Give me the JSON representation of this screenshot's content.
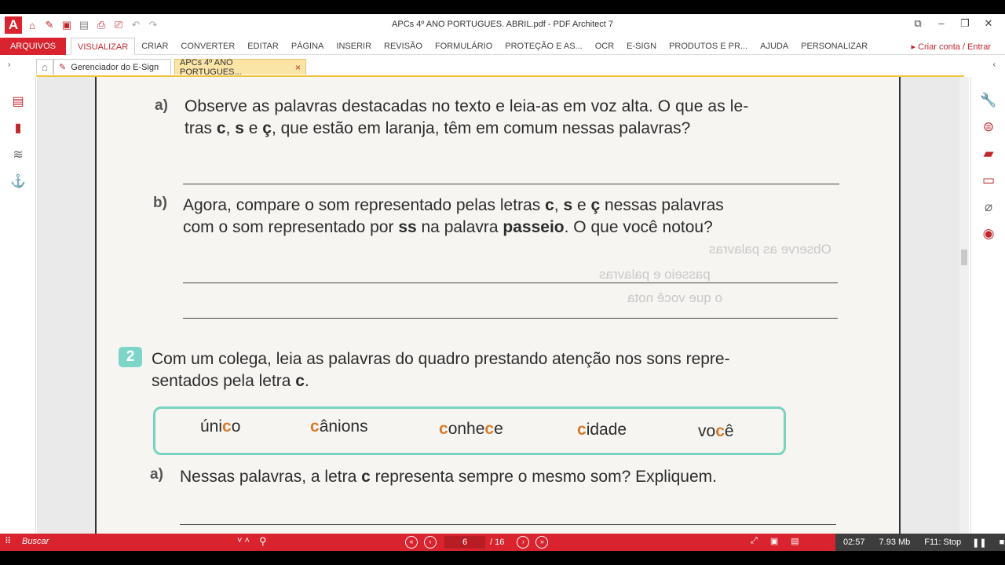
{
  "window": {
    "title": "APCs 4º ANO PORTUGUES. ABRIL.pdf   -   PDF Architect 7",
    "logo": "A",
    "quick_access_icons": [
      "home-icon",
      "pen-icon",
      "open-icon",
      "save-icon",
      "print-icon",
      "print-preview-icon",
      "undo-icon",
      "redo-icon"
    ],
    "controls": [
      "restore-icon",
      "minimize-icon",
      "maximize-icon",
      "close-icon"
    ]
  },
  "menu": {
    "file_label": "ARQUIVOS",
    "items": [
      "VISUALIZAR",
      "CRIAR",
      "CONVERTER",
      "EDITAR",
      "PÁGINA",
      "INSERIR",
      "REVISÃO",
      "FORMULÁRIO",
      "PROTEÇÃO E AS...",
      "OCR",
      "E-SIGN",
      "PRODUTOS E PR...",
      "AJUDA",
      "PERSONALIZAR"
    ],
    "active": "VISUALIZAR",
    "account_label": "Criar conta / Entrar"
  },
  "tabs": [
    {
      "label": "Gerenciador do E-Sign"
    },
    {
      "label": "APCs 4º ANO PORTUGUES...",
      "close": "×"
    }
  ],
  "document": {
    "q_a_label": "a)",
    "q_a_line1_pre": "Observe as palavras destacadas no texto e leia-as em voz alta. O que as le-",
    "q_a_line2": [
      "tras ",
      "c",
      ", ",
      "s",
      " e ",
      "ç",
      ", que estão em laranja, têm em comum nessas palavras?"
    ],
    "q_b_label": "b)",
    "q_b_line1": [
      "Agora, compare o som representado pelas letras ",
      "c",
      ", ",
      "s",
      " e ",
      "ç",
      " nessas palavras"
    ],
    "q_b_line2": [
      "com o som representado por ",
      "ss",
      " na palavra ",
      "passeio",
      ". O que você notou?"
    ],
    "q2_number": "2",
    "q2_line1": "Com um colega, leia as palavras do quadro prestando atenção nos sons repre-",
    "q2_line2": [
      "sentados pela letra ",
      "c",
      "."
    ],
    "words": [
      {
        "pre": "úni",
        "hi": "c",
        "post": "o"
      },
      {
        "pre": "",
        "hi": "c",
        "post": "ânions"
      },
      {
        "pre": "",
        "hi": "c",
        "post": "onhe",
        "hi2": "c",
        "post2": "e"
      },
      {
        "pre": "",
        "hi": "c",
        "post": "idade"
      },
      {
        "pre": "vo",
        "hi": "c",
        "post": "ê"
      }
    ],
    "q2a_label": "a)",
    "q2a_line": [
      "Nessas palavras, a letra ",
      "c",
      " representa sempre o mesmo som? Expliquem."
    ],
    "bleed_through": [
      "Observe as palavras",
      "passeio e palavras",
      "o que você nota"
    ]
  },
  "statusbar": {
    "search_placeholder": "Buscar",
    "current_page": "6",
    "total_pages": "/ 16",
    "time": "02:57",
    "size": "7.93 Mb",
    "hotkey": "F11: Stop"
  }
}
